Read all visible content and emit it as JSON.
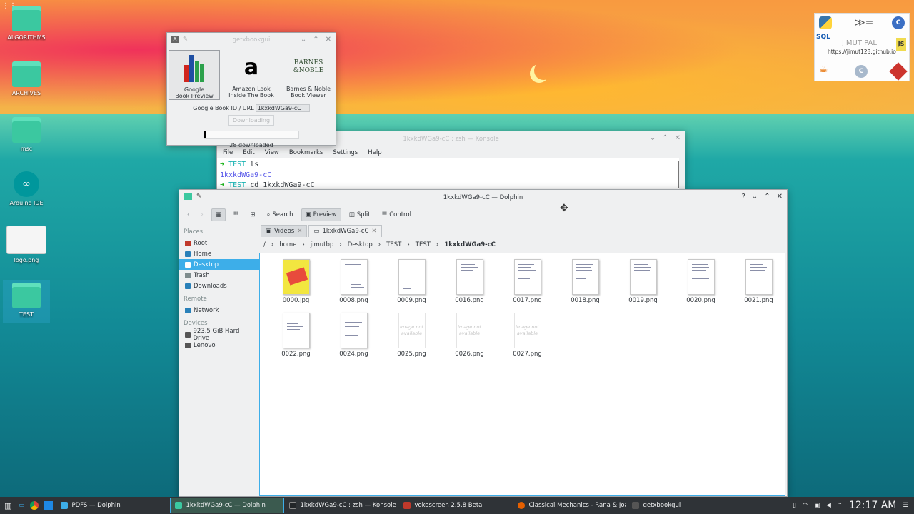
{
  "desktop": {
    "icons": [
      {
        "label": "ALGORITHMS",
        "glyph": "folder-icon"
      },
      {
        "label": "ARCHIVES",
        "glyph": "folder-icon"
      },
      {
        "label": "msc",
        "glyph": "folder-icon"
      },
      {
        "label": "Arduino IDE",
        "glyph": "arduino-icon"
      },
      {
        "label": "logo.png",
        "glyph": "image-icon"
      },
      {
        "label": "TEST",
        "glyph": "folder-icon"
      }
    ],
    "widget": {
      "name": "JIMUT PAL",
      "url": "https://jimut123.github.io",
      "sql": "SQL"
    }
  },
  "getxbookgui": {
    "title": "getxbookgui",
    "sources": [
      {
        "label1": "Google",
        "label2": "Book Preview"
      },
      {
        "label1": "Amazon Look",
        "label2": "Inside The Book"
      },
      {
        "label1": "Barnes & Noble",
        "label2": "Book Viewer"
      }
    ],
    "bn_logo_l1": "BARNES",
    "bn_logo_l2": "&NOBLE",
    "id_label": "Google Book ID / URL",
    "id_value": "1kxkdWGa9-cC",
    "download_button": "Downloading",
    "progress": 0.0,
    "status": "28 downloaded"
  },
  "konsole": {
    "title": "1kxkdWGa9-cC : zsh — Konsole",
    "menu": [
      "File",
      "Edit",
      "View",
      "Bookmarks",
      "Settings",
      "Help"
    ],
    "lines": [
      {
        "prompt": "➜",
        "dir": "TEST",
        "cmd": "ls"
      },
      {
        "output": "1kxkdWGa9-cC"
      },
      {
        "prompt": "➜",
        "dir": "TEST",
        "cmd": "cd 1kxkdWGa9-cC"
      }
    ]
  },
  "dolphin": {
    "title": "1kxkdWGa9-cC — Dolphin",
    "toolbar": {
      "search": "Search",
      "preview": "Preview",
      "split": "Split",
      "control": "Control"
    },
    "places": {
      "places_header": "Places",
      "places": [
        "Root",
        "Home",
        "Desktop",
        "Trash",
        "Downloads"
      ],
      "remote_header": "Remote",
      "remote": [
        "Network"
      ],
      "devices_header": "Devices",
      "devices": [
        "923.5 GiB Hard Drive",
        "Lenovo"
      ]
    },
    "tabs": [
      "Videos",
      "1kxkdWGa9-cC"
    ],
    "breadcrumb": [
      "/",
      "home",
      "jimutbp",
      "Desktop",
      "TEST",
      "TEST",
      "1kxkdWGa9-cC"
    ],
    "na_text": "image not available",
    "files": [
      "0000.jpg",
      "0008.png",
      "0009.png",
      "0016.png",
      "0017.png",
      "0018.png",
      "0019.png",
      "0020.png",
      "0021.png",
      "0022.png",
      "0024.png",
      "0025.png",
      "0026.png",
      "0027.png"
    ]
  },
  "taskbar": {
    "tasks": [
      {
        "label": "PDFS — Dolphin",
        "color": "#3daee9"
      },
      {
        "label": "1kxkdWGa9-cC — Dolphin",
        "color": "#3bc8a0"
      },
      {
        "label": "1kxkdWGa9-cC : zsh — Konsole",
        "color": "#232629"
      },
      {
        "label": "vokoscreen 2.5.8 Beta",
        "color": "#c0392b"
      },
      {
        "label": "Classical Mechanics - Rana & Joa...",
        "color": "#e66000"
      },
      {
        "label": "getxbookgui",
        "color": "#555"
      }
    ],
    "clock": "12:17 AM"
  }
}
